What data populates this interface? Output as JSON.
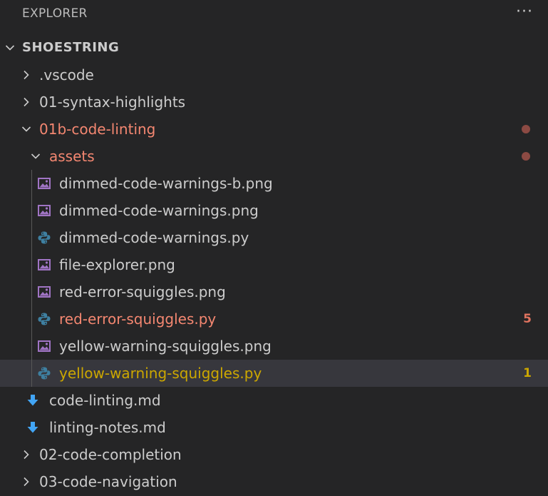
{
  "colors": {
    "background": "#252526",
    "text": "#cccccc",
    "modified_red": "#f48771",
    "warning_yellow": "#cca700",
    "dot_color": "#8c4a43",
    "selected_row": "#37373d",
    "image_icon": "#a074c4",
    "python_icon": "#3e7fa0",
    "markdown_icon": "#42a5f5"
  },
  "header": {
    "title": "EXPLORER",
    "more_actions": "···",
    "more_icon": "ellipsis-icon"
  },
  "tree": {
    "root": {
      "label": "SHOESTRING",
      "expanded": true
    },
    "items": [
      {
        "label": ".vscode",
        "type": "folder",
        "expanded": false
      },
      {
        "label": "01-syntax-highlights",
        "type": "folder",
        "expanded": false
      },
      {
        "label": "01b-code-linting",
        "type": "folder",
        "expanded": true,
        "modified": true
      },
      {
        "label": "assets",
        "type": "folder",
        "expanded": true,
        "modified": true
      },
      {
        "label": "dimmed-code-warnings-b.png",
        "type": "image"
      },
      {
        "label": "dimmed-code-warnings.png",
        "type": "image"
      },
      {
        "label": "dimmed-code-warnings.py",
        "type": "python"
      },
      {
        "label": "file-explorer.png",
        "type": "image"
      },
      {
        "label": "red-error-squiggles.png",
        "type": "image"
      },
      {
        "label": "red-error-squiggles.py",
        "type": "python",
        "status": "error",
        "badge": "5"
      },
      {
        "label": "yellow-warning-squiggles.png",
        "type": "image"
      },
      {
        "label": "yellow-warning-squiggles.py",
        "type": "python",
        "status": "warning",
        "badge": "1",
        "selected": true
      },
      {
        "label": "code-linting.md",
        "type": "markdown"
      },
      {
        "label": "linting-notes.md",
        "type": "markdown"
      },
      {
        "label": "02-code-completion",
        "type": "folder",
        "expanded": false
      },
      {
        "label": "03-code-navigation",
        "type": "folder",
        "expanded": false
      }
    ]
  }
}
